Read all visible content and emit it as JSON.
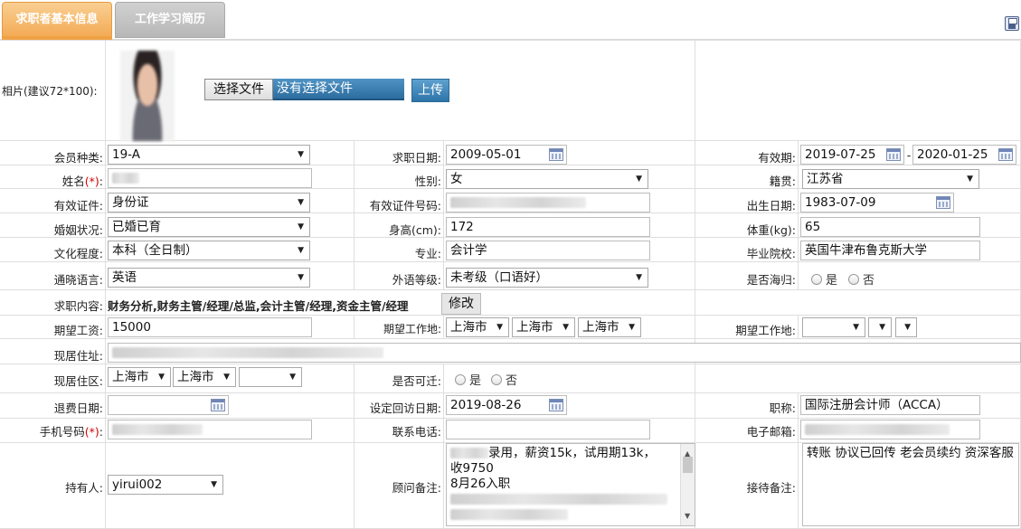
{
  "tabs": {
    "basic_info": "求职者基本信息",
    "work_history": "工作学习简历"
  },
  "photo": {
    "label": "相片(建议72*100):",
    "choose_file": "选择文件",
    "no_file": "没有选择文件",
    "upload": "上传"
  },
  "labels": {
    "member_type": "会员种类:",
    "job_date": "求职日期:",
    "valid_period": "有效期:",
    "name": "姓名",
    "gender": "性别:",
    "origin": "籍贯:",
    "id_type": "有效证件:",
    "id_number": "有效证件号码:",
    "birth": "出生日期:",
    "marital": "婚姻状况:",
    "height": "身高(cm):",
    "weight": "体重(kg):",
    "education": "文化程度:",
    "major": "专业:",
    "school": "毕业院校:",
    "language": "通晓语言:",
    "lang_level": "外语等级:",
    "returnee": "是否海归:",
    "job_content": "求职内容:",
    "salary": "期望工资:",
    "work_place": "期望工作地:",
    "work_place2": "期望工作地:",
    "address": "现居住址:",
    "district": "现居住区:",
    "relocate": "是否可迁:",
    "refund_date": "退费日期:",
    "callback_date": "设定回访日期:",
    "title": "职称:",
    "mobile": "手机号码",
    "phone": "联系电话:",
    "email": "电子邮箱:",
    "holder": "持有人:",
    "advisor_note": "顾问备注:",
    "reception_note": "接待备注:",
    "required_mark": "(*)",
    "colon": ":"
  },
  "values": {
    "member_type": "19-A",
    "job_date": "2009-05-01",
    "valid_from": "2019-07-25",
    "valid_to": "2020-01-25",
    "gender": "女",
    "origin": "江苏省",
    "id_type": "身份证",
    "birth": "1983-07-09",
    "marital": "已婚已育",
    "height": "172",
    "weight": "65",
    "education": "本科（全日制）",
    "major": "会计学",
    "school": "英国牛津布鲁克斯大学",
    "language": "英语",
    "lang_level": "未考级（口语好）",
    "job_content": "财务分析,财务主管/经理/总监,会计主管/经理,资金主管/经理",
    "salary": "15000",
    "place1": "上海市",
    "place2": "上海市",
    "place3": "上海市",
    "district1": "上海市",
    "district2": "上海市",
    "callback_date": "2019-08-26",
    "title": "国际注册会计师（ACCA）",
    "holder": "yirui002",
    "advisor_note_line1": "录用，薪资15k，试用期13k，",
    "advisor_note_line2": "收9750",
    "advisor_note_line3": "8月26入职",
    "reception_note": "转账 协议已回传 老会员续约 资深客服"
  },
  "radio": {
    "yes": "是",
    "no": "否"
  },
  "buttons": {
    "modify": "修改"
  },
  "icons": [
    "save-icon",
    "calendar-icon",
    "dropdown-arrow-icon",
    "radio-icon"
  ]
}
